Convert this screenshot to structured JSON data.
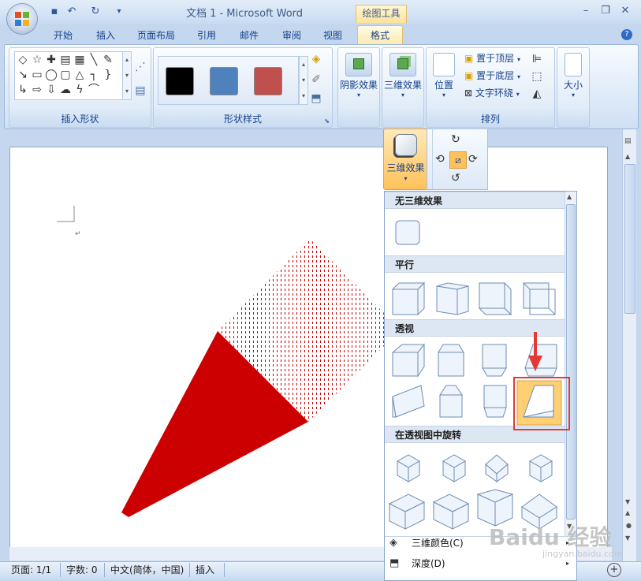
{
  "window": {
    "title": "文档 1 - Microsoft Word",
    "context_tool": "绘图工具"
  },
  "tabs": [
    "开始",
    "插入",
    "页面布局",
    "引用",
    "邮件",
    "审阅",
    "视图"
  ],
  "active_tab": "格式",
  "ribbon": {
    "groups": {
      "insert_shapes": "插入形状",
      "shape_styles": "形状样式",
      "shadow": "阴影效果",
      "three_d": "三维效果",
      "arrange": "排列",
      "size": "大小"
    },
    "arrange_buttons": {
      "position": "位置",
      "bring_front": "置于顶层",
      "send_back": "置于底层",
      "text_wrap": "文字环绕"
    },
    "swatch_colors": [
      "#000000",
      "#4f81bd",
      "#c0504d"
    ]
  },
  "three_d_button": "三维效果",
  "dropdown": {
    "sections": [
      "无三维效果",
      "平行",
      "透视",
      "在透视图中旋转"
    ],
    "menu_items": [
      {
        "label": "三维颜色(C)"
      },
      {
        "label": "深度(D)"
      }
    ]
  },
  "status": {
    "page": "页面: 1/1",
    "words": "字数: 0",
    "lang": "中文(简体，中国)",
    "mode": "插入"
  },
  "watermark": {
    "text": "Baidu 经验",
    "sub": "jingyan.baidu.com"
  },
  "colors": {
    "shape_red": "#cc0000",
    "highlight": "#e53935",
    "accent": "#ffc25a"
  }
}
